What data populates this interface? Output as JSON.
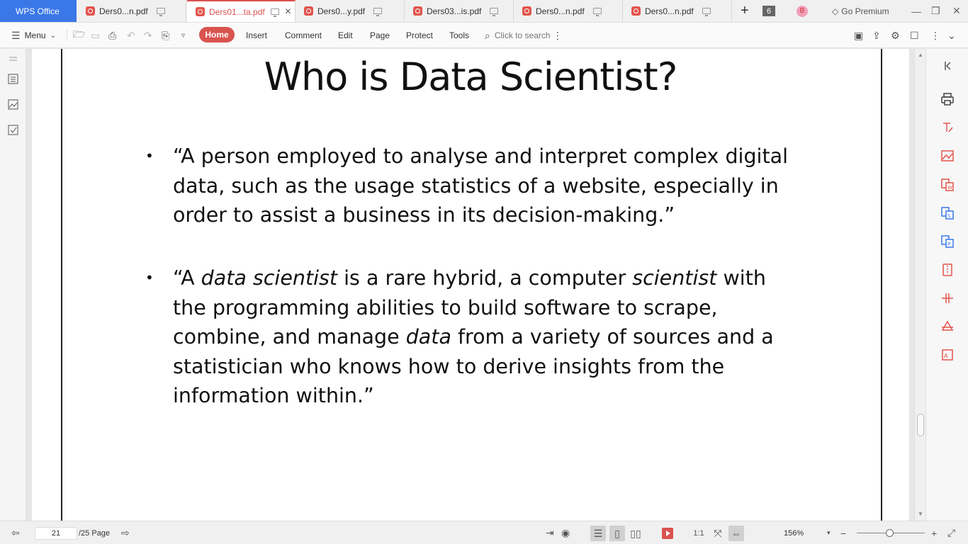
{
  "app": {
    "brand": "WPS Office"
  },
  "tabs": [
    {
      "label": "Ders0...n.pdf",
      "active": false
    },
    {
      "label": "Ders01...ta.pdf",
      "active": true
    },
    {
      "label": "Ders0...y.pdf",
      "active": false
    },
    {
      "label": "Ders03...is.pdf",
      "active": false
    },
    {
      "label": "Ders0...n.pdf",
      "active": false
    },
    {
      "label": "Ders0...n.pdf",
      "active": false
    }
  ],
  "tabbar": {
    "tab_count": "6",
    "user_initial": "B",
    "premium_label": "Go Premium"
  },
  "toolbar": {
    "menu_label": "Menu",
    "home": "Home",
    "insert": "Insert",
    "comment": "Comment",
    "edit": "Edit",
    "page": "Page",
    "protect": "Protect",
    "tools": "Tools",
    "search_placeholder": "Click to search"
  },
  "document": {
    "title": "Who is Data Scientist?",
    "bullet1": "“A person employed to analyse and interpret complex digital data, such as the usage statistics of a website, especially in order to assist a business in its decision-making.”",
    "bullet2_parts": {
      "p1": "“A ",
      "i1": "data scientist",
      "p2": " is a rare hybrid, a computer ",
      "i2": "scientist",
      "p3": " with the programming abilities to build software to scrape, combine, and manage ",
      "i3": "data",
      "p4": " from a variety of sources and a statistician who knows how to derive insights from the information within.”"
    }
  },
  "status": {
    "current_page": "21",
    "total_pages": "/25 Page",
    "zoom": "156%"
  },
  "colors": {
    "accent": "#d9534f",
    "brand": "#3b78e7"
  }
}
